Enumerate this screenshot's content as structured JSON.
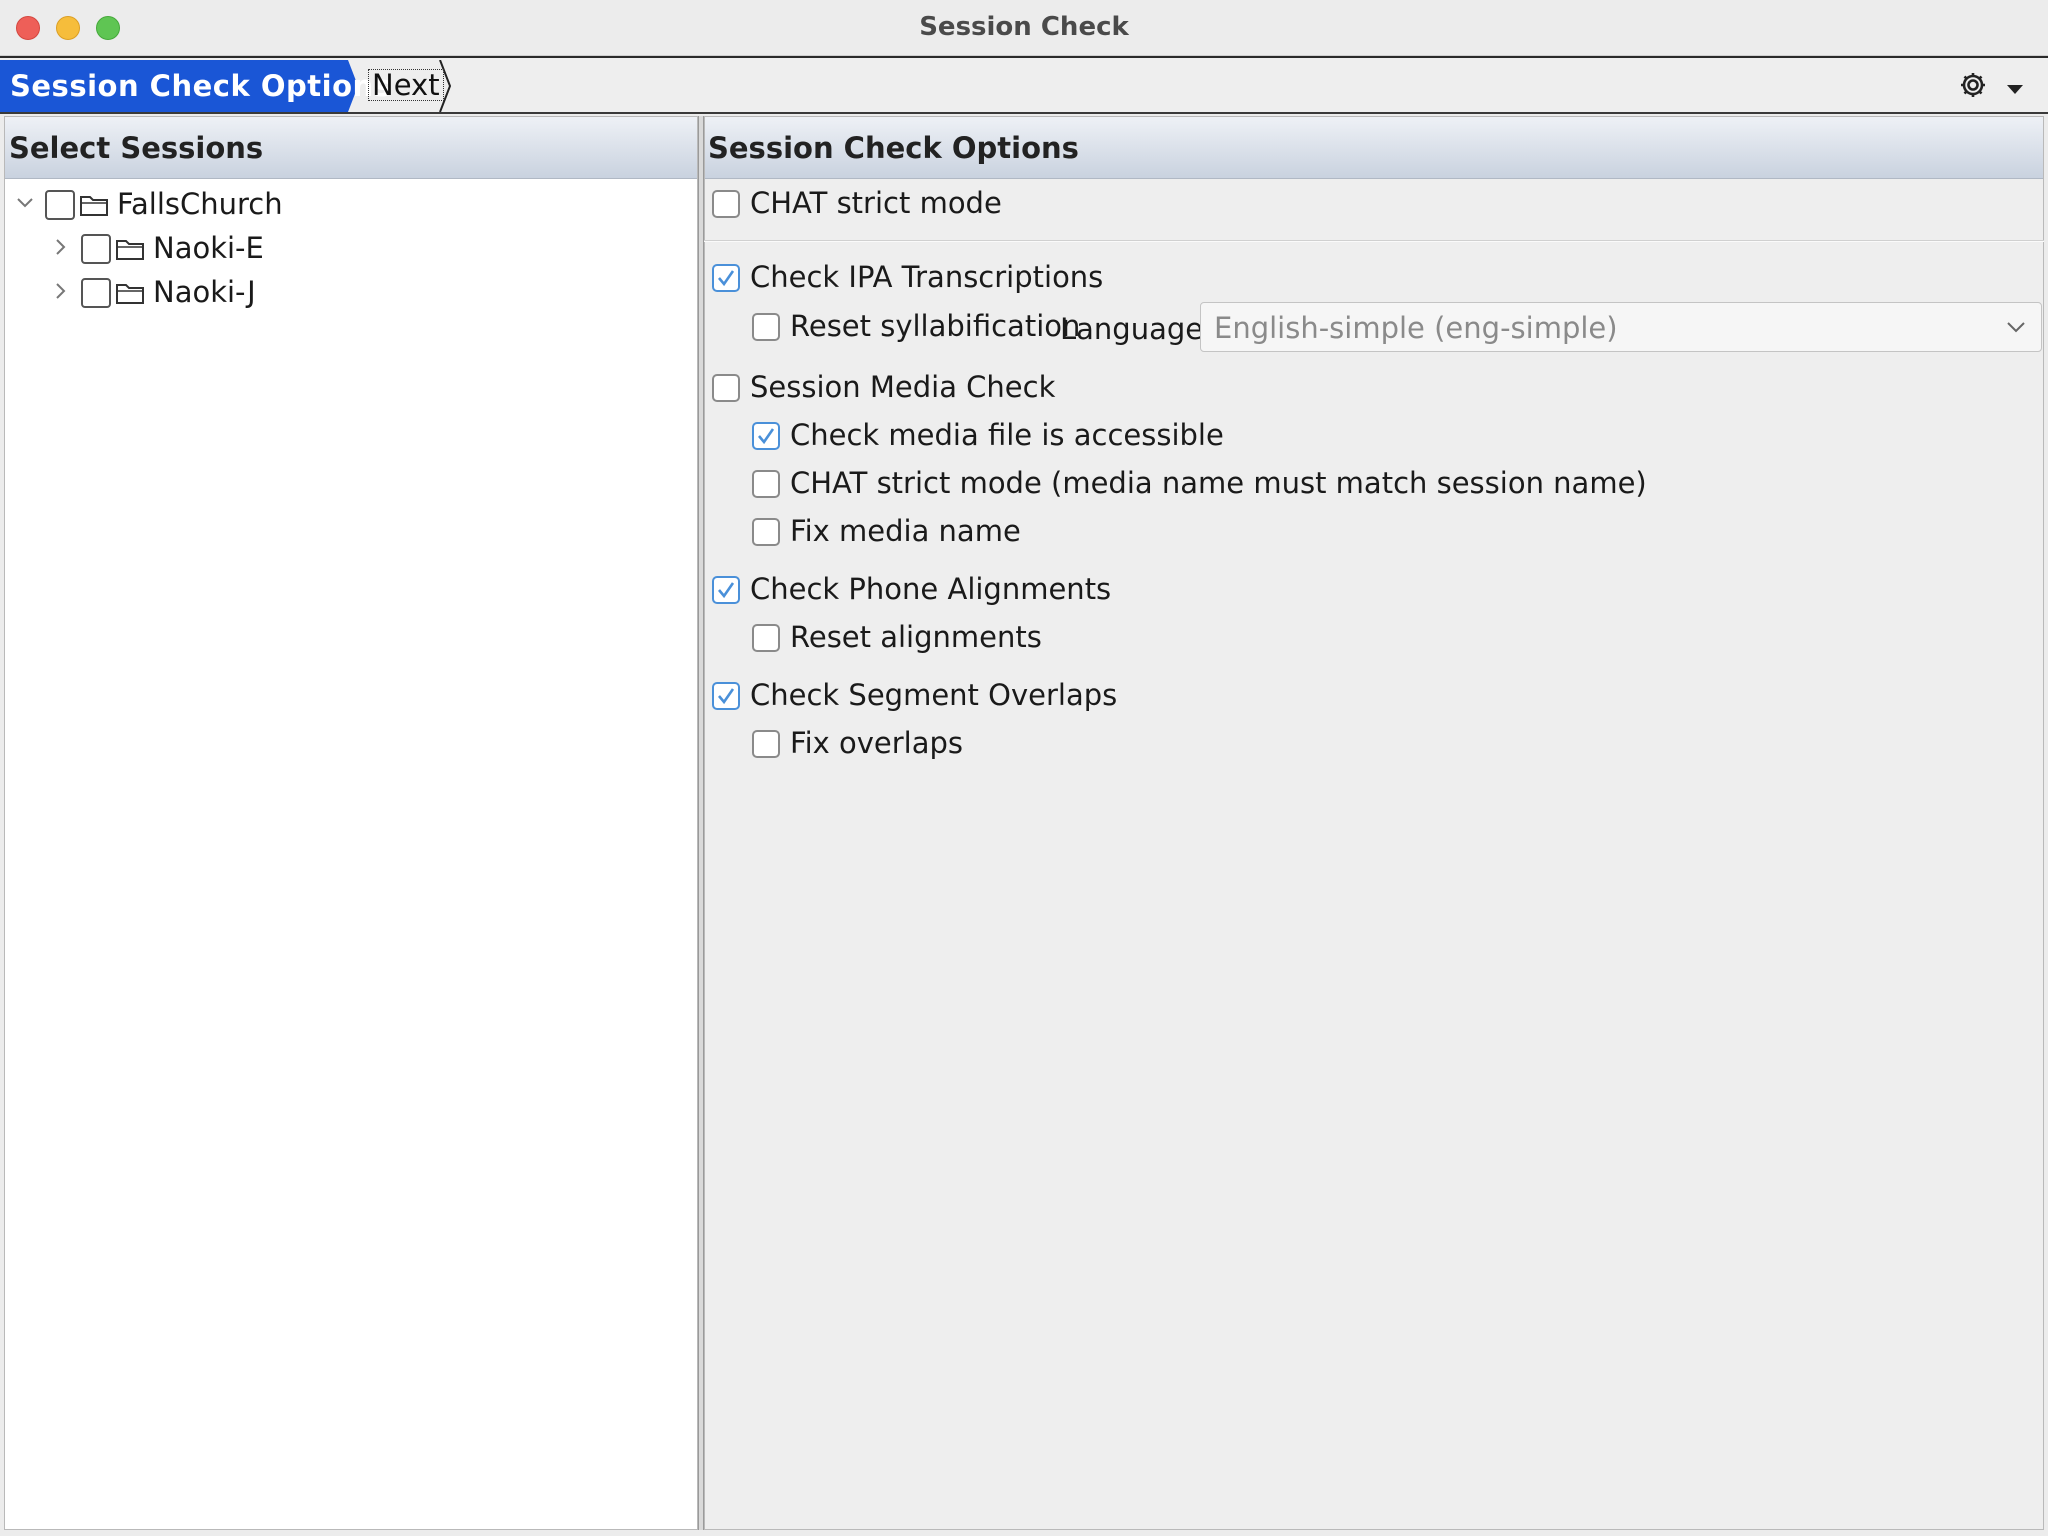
{
  "window": {
    "title": "Session Check"
  },
  "breadcrumb": {
    "active": "Session Check Options",
    "next": "Next"
  },
  "toolbar": {
    "gear_icon": "gear-icon",
    "menu_icon": "dropdown-arrow-icon"
  },
  "left_panel": {
    "header": "Select Sessions",
    "tree": [
      {
        "label": "FallsChurch",
        "expanded": true,
        "checked": false,
        "level": 0
      },
      {
        "label": "Naoki-E",
        "expanded": false,
        "checked": false,
        "level": 1
      },
      {
        "label": "Naoki-J",
        "expanded": false,
        "checked": false,
        "level": 1
      }
    ]
  },
  "right_panel": {
    "header": "Session Check Options",
    "options": {
      "chat_strict": {
        "label": "CHAT strict mode",
        "checked": false
      },
      "check_ipa": {
        "label": "Check IPA Transcriptions",
        "checked": true
      },
      "reset_syllab": {
        "label": "Reset syllabification",
        "checked": false
      },
      "language_label": "Language:",
      "language_value": "English-simple (eng-simple)",
      "media_check": {
        "label": "Session Media Check",
        "checked": false
      },
      "media_accessible": {
        "label": "Check media file is accessible",
        "checked": true
      },
      "media_chat_strict": {
        "label": "CHAT strict mode (media name must match session name)",
        "checked": false
      },
      "fix_media_name": {
        "label": "Fix media name",
        "checked": false
      },
      "phone_align": {
        "label": "Check Phone Alignments",
        "checked": true
      },
      "reset_align": {
        "label": "Reset alignments",
        "checked": false
      },
      "seg_overlap": {
        "label": "Check Segment Overlaps",
        "checked": true
      },
      "fix_overlaps": {
        "label": "Fix overlaps",
        "checked": false
      }
    }
  },
  "colors": {
    "breadcrumb_active": "#1a56d6",
    "checkbox_checked": "#4a90d9"
  }
}
